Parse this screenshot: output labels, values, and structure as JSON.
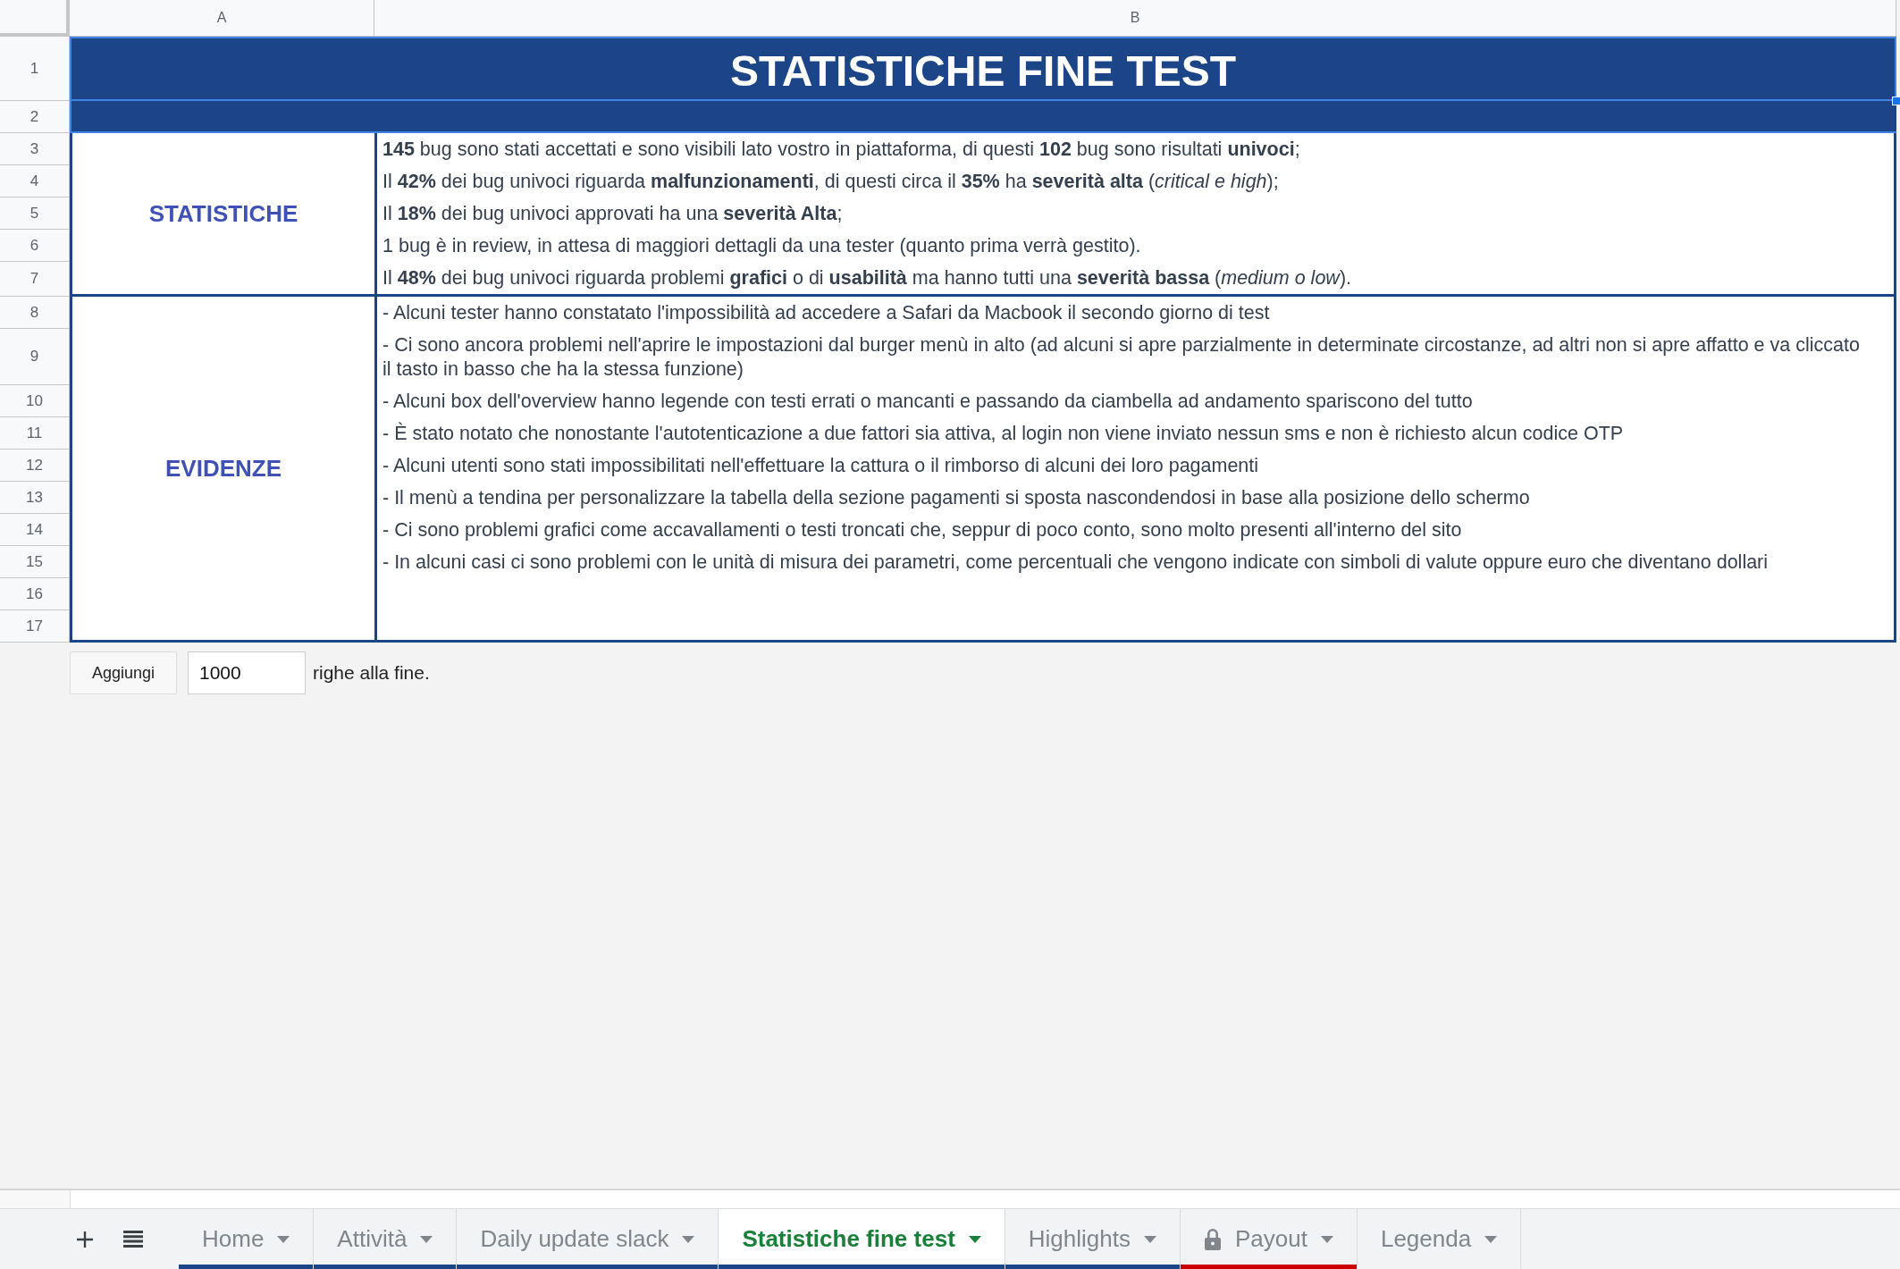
{
  "columns": [
    "A",
    "B"
  ],
  "row_numbers": [
    "1",
    "2",
    "3",
    "4",
    "5",
    "6",
    "7",
    "8",
    "9",
    "10",
    "11",
    "12",
    "13",
    "14",
    "15",
    "16",
    "17"
  ],
  "title": {
    "text": "STATISTICHE FINE TEST",
    "selected": true
  },
  "sections": [
    {
      "label": "STATISTICHE",
      "lines": [
        "**145** bug sono stati accettati e sono visibili lato vostro in piattaforma, di questi **102** bug sono risultati **univoci**;",
        "Il **42%** dei bug univoci riguarda **malfunzionamenti**, di questi circa il **35%** ha **severità alta** (*critical e high*);",
        "Il **18%** dei bug univoci approvati ha una **severità Alta**;",
        "1 bug è in review, in attesa di maggiori dettagli da una tester (quanto prima verrà gestito).",
        "Il **48%** dei bug univoci riguarda problemi **grafici** o di **usabilità** ma hanno tutti una **severità bassa** (*medium o low*)."
      ]
    },
    {
      "label": "EVIDENZE",
      "lines": [
        "- Alcuni tester hanno constatato l'impossibilità ad accedere a Safari da Macbook il secondo giorno di test",
        "- Ci sono ancora problemi nell'aprire le impostazioni dal burger menù in alto (ad alcuni si apre parzialmente in determinate circostanze, ad altri non si apre affatto e va cliccato il tasto in basso che ha la stessa funzione)",
        "- Alcuni box dell'overview hanno legende con testi errati o mancanti e passando da ciambella ad andamento spariscono del tutto",
        "- È stato notato che nonostante l'autotenticazione a due fattori sia attiva, al login non viene inviato nessun sms e non è richiesto alcun codice OTP",
        "- Alcuni utenti sono stati impossibilitati nell'effettuare la cattura o il rimborso di alcuni dei loro pagamenti",
        "- Il menù a tendina per personalizzare la tabella della sezione pagamenti si sposta nascondendosi in base alla posizione dello schermo",
        "- Ci sono problemi grafici come accavallamenti o testi troncati che, seppur di poco conto, sono molto presenti all'interno del sito",
        "- In alcuni casi ci sono problemi con le unità di misura dei parametri, come percentuali che vengono indicate con simboli di valute oppure euro che diventano dollari"
      ]
    }
  ],
  "add_rows": {
    "button": "Aggiungi",
    "value": "1000",
    "text": "righe alla fine."
  },
  "sheet_tabs": [
    {
      "label": "Home",
      "selected": false,
      "locked": false,
      "color": "#1c4587"
    },
    {
      "label": "Attività",
      "selected": false,
      "locked": false,
      "color": "#1c4587"
    },
    {
      "label": "Daily update slack",
      "selected": false,
      "locked": false,
      "color": "#1c4587"
    },
    {
      "label": "Statistiche fine test",
      "selected": true,
      "locked": false,
      "color": "#1c4587"
    },
    {
      "label": "Highlights",
      "selected": false,
      "locked": false,
      "color": "#1c4587"
    },
    {
      "label": "Payout",
      "selected": false,
      "locked": true,
      "color": "#cc0000"
    },
    {
      "label": "Legenda",
      "selected": false,
      "locked": false
    }
  ]
}
